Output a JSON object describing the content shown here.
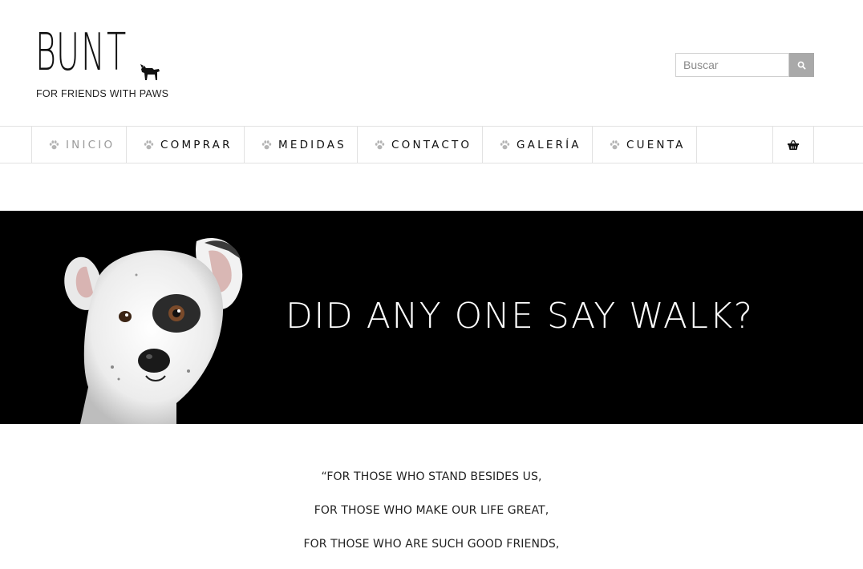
{
  "header": {
    "logo_word": "BUNT",
    "logo_tagline": "FOR FRIENDS WITH PAWS",
    "search_placeholder": "Buscar",
    "search_button_icon": "search-icon"
  },
  "nav": {
    "items": [
      {
        "label": "INICIO",
        "icon": "paw-icon",
        "active": true
      },
      {
        "label": "COMPRAR",
        "icon": "paw-icon",
        "active": false
      },
      {
        "label": "MEDIDAS",
        "icon": "paw-icon",
        "active": false
      },
      {
        "label": "CONTACTO",
        "icon": "paw-icon",
        "active": false
      },
      {
        "label": "GALERÍA",
        "icon": "paw-icon",
        "active": false
      },
      {
        "label": "CUENTA",
        "icon": "paw-icon",
        "active": false
      }
    ],
    "cart_icon": "shopping-basket-icon"
  },
  "hero": {
    "title": "DID ANY ONE SAY WALK?",
    "background": "#000000"
  },
  "quote": {
    "lines": [
      "“FOR THOSE WHO STAND BESIDES US,",
      "FOR THOSE WHO MAKE OUR LIFE GREAT,",
      "FOR THOSE WHO ARE SUCH GOOD FRIENDS,"
    ]
  },
  "colors": {
    "accent_inactive_nav": "#9a9a9a",
    "search_button": "#a9a9a9",
    "border": "#e2e2e2"
  }
}
